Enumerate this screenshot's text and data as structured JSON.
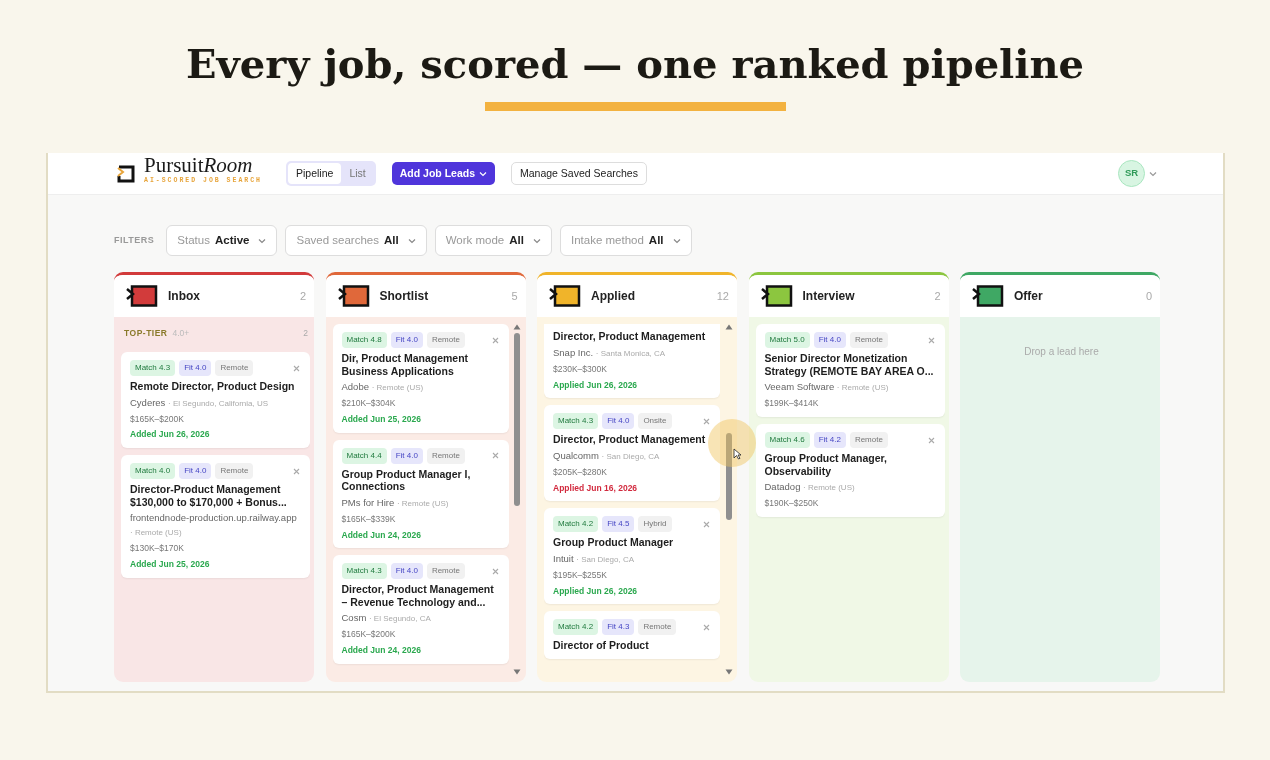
{
  "headline": "Every job, scored — one ranked pipeline",
  "app": {
    "logo": "Pursuit",
    "logo_accent": "Room",
    "tagline": "AI-SCORED JOB SEARCH",
    "views": [
      {
        "label": "Pipeline",
        "selected": true
      },
      {
        "label": "List",
        "selected": false
      }
    ],
    "add_button": "Add Job Leads",
    "manage_button": "Manage Saved Searches",
    "avatar": "SR",
    "filters_label": "FILTERS",
    "filters": [
      {
        "label": "Status",
        "value": "Active"
      },
      {
        "label": "Saved searches",
        "value": "All"
      },
      {
        "label": "Work mode",
        "value": "All"
      },
      {
        "label": "Intake method",
        "value": "All"
      }
    ],
    "columns": [
      {
        "title": "Inbox",
        "count": "2",
        "color": "#d23b3b",
        "scrollbar": false,
        "group": {
          "label": "TOP-TIER",
          "range": "4.0+",
          "count": "2"
        },
        "cards": [
          {
            "match": "Match 4.3",
            "fit": "Fit 4.0",
            "mode": "Remote",
            "title": "Remote Director, Product Design",
            "company": "Cyderes",
            "location": "· El Segundo, California, US",
            "salary": "$165K–$200K",
            "date": "Added Jun 26, 2026",
            "overdue": false
          },
          {
            "match": "Match 4.0",
            "fit": "Fit 4.0",
            "mode": "Remote",
            "title": "Director-Product Management $130,000 to $170,000 + Bonus...",
            "company": "frontendnode-production.up.railway.app",
            "location": "· Remote (US)",
            "salary": "$130K–$170K",
            "date": "Added Jun 25, 2026",
            "overdue": false
          }
        ]
      },
      {
        "title": "Shortlist",
        "count": "5",
        "color": "#e0683a",
        "scrollbar": true,
        "cards": [
          {
            "match": "Match 4.8",
            "fit": "Fit 4.0",
            "mode": "Remote",
            "title": "Dir, Product Management Business Applications",
            "company": "Adobe",
            "location": "· Remote (US)",
            "salary": "$210K–$304K",
            "date": "Added Jun 25, 2026",
            "overdue": false
          },
          {
            "match": "Match 4.4",
            "fit": "Fit 4.0",
            "mode": "Remote",
            "title": "Group Product Manager I, Connections",
            "company": "PMs for Hire",
            "location": "· Remote (US)",
            "salary": "$165K–$339K",
            "date": "Added Jun 24, 2026",
            "overdue": false
          },
          {
            "match": "Match 4.3",
            "fit": "Fit 4.0",
            "mode": "Remote",
            "title": "Director, Product Management – Revenue Technology and...",
            "company": "Cosm",
            "location": "· El Segundo, CA",
            "salary": "$165K–$200K",
            "date": "Added Jun 24, 2026",
            "overdue": false
          }
        ]
      },
      {
        "title": "Applied",
        "count": "12",
        "color": "#f0b42a",
        "scrollbar": true,
        "cards": [
          {
            "title": "Director, Product Management",
            "company": "Snap Inc.",
            "location": "· Santa Monica, CA",
            "salary": "$230K–$300K",
            "date": "Applied Jun 26, 2026",
            "overdue": false
          },
          {
            "match": "Match 4.3",
            "fit": "Fit 4.0",
            "mode": "Onsite",
            "title": "Director, Product Management",
            "company": "Qualcomm",
            "location": "· San Diego, CA",
            "salary": "$205K–$280K",
            "date": "Applied Jun 16, 2026",
            "overdue": true
          },
          {
            "match": "Match 4.2",
            "fit": "Fit 4.5",
            "mode": "Hybrid",
            "title": "Group Product Manager",
            "company": "Intuit",
            "location": "· San Diego, CA",
            "salary": "$195K–$255K",
            "date": "Applied Jun 26, 2026",
            "overdue": false
          },
          {
            "match": "Match 4.2",
            "fit": "Fit 4.3",
            "mode": "Remote",
            "title": "Director of Product"
          }
        ]
      },
      {
        "title": "Interview",
        "count": "2",
        "color": "#8cc63f",
        "scrollbar": false,
        "cards": [
          {
            "match": "Match 5.0",
            "fit": "Fit 4.0",
            "mode": "Remote",
            "title": "Senior Director Monetization Strategy (REMOTE BAY AREA O...",
            "company": "Veeam Software",
            "location": "· Remote (US)",
            "salary": "$199K–$414K"
          },
          {
            "match": "Match 4.6",
            "fit": "Fit 4.2",
            "mode": "Remote",
            "title": "Group Product Manager, Observability",
            "company": "Datadog",
            "location": "· Remote (US)",
            "salary": "$190K–$250K"
          }
        ]
      },
      {
        "title": "Offer",
        "count": "0",
        "color": "#3fa864",
        "scrollbar": false,
        "empty": "Drop a lead here"
      }
    ]
  }
}
